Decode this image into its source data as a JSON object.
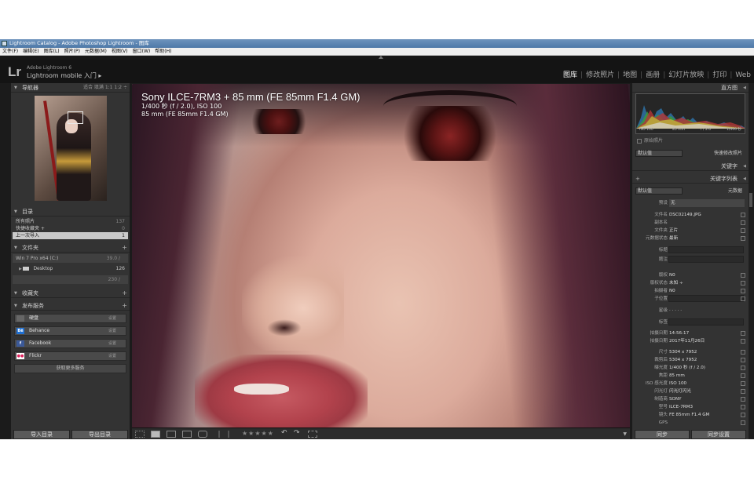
{
  "window": {
    "title": "Lightroom Catalog - Adobe Photoshop Lightroom - 图库"
  },
  "menu": [
    "文件(F)",
    "编辑(E)",
    "图库(L)",
    "照片(P)",
    "元数据(M)",
    "视图(V)",
    "窗口(W)",
    "帮助(H)"
  ],
  "identity": {
    "logo": "Lr",
    "line1": "Adobe Lightroom 6",
    "line2": "Lightroom mobile 入门 ▸"
  },
  "modules": [
    "图库",
    "修改照片",
    "地图",
    "画册",
    "幻灯片放映",
    "打印",
    "Web"
  ],
  "navigator": {
    "title": "导航器",
    "zoom": "适合   填满   1:1   1:2 ÷"
  },
  "catalog": {
    "title": "目录",
    "items": [
      {
        "label": "所有照片",
        "count": "137"
      },
      {
        "label": "快捷收藏夹 +",
        "count": "0"
      },
      {
        "label": "上一次导入",
        "count": "1"
      }
    ]
  },
  "folders": {
    "title": "文件夹",
    "volumes": [
      {
        "label": "Win 7 Pro x64 (C:)",
        "count": "39.0 / "
      },
      {
        "label": "",
        "count": "230 / "
      }
    ],
    "folder_items": [
      {
        "label": "Desktop",
        "count": "126"
      }
    ]
  },
  "collections": {
    "title": "收藏夹"
  },
  "publish": {
    "title": "发布服务",
    "services": [
      {
        "badge": "",
        "label": "硬盘",
        "set": "设置"
      },
      {
        "badge": "Bē",
        "label": "Behance",
        "set": "设置"
      },
      {
        "badge": "f",
        "label": "Facebook",
        "set": "设置"
      },
      {
        "badge": "●●",
        "label": "Flickr",
        "set": "设置"
      }
    ],
    "more": "获取更多服务"
  },
  "left_buttons": {
    "import": "导入目录",
    "export": "导出目录"
  },
  "overlay": {
    "line1": "Sony ILCE-7RM3 + 85 mm (FE 85mm F1.4 GM)",
    "line2": "1/400 秒 (f / 2.0), ISO 100",
    "line3": "85 mm (FE 85mm F1.4 GM)"
  },
  "toolbar": {
    "stars": "★★★★★"
  },
  "histogram": {
    "title": "直方图",
    "iso": "ISO 100",
    "focal": "85 mm",
    "aperture": "f / 2.0",
    "shutter": "1/400 秒",
    "original": "原始照片"
  },
  "quick_develop": {
    "preset": "默认值",
    "title": "快速修改照片"
  },
  "keywording": {
    "title": "关键字"
  },
  "keyword_list": {
    "title": "关键字列表"
  },
  "metadata": {
    "preset": "默认值",
    "title": "元数据",
    "preset_label": "预设",
    "preset_value": "无",
    "rows": [
      {
        "k": "文件名",
        "v": "DSC02149.JPG"
      },
      {
        "k": "副本名",
        "v": ""
      },
      {
        "k": "文件夹",
        "v": "正片"
      },
      {
        "k": "元数据状态",
        "v": "最新"
      },
      {
        "k": "标题",
        "v": ""
      },
      {
        "k": "题注",
        "v": ""
      },
      {
        "k": "版权",
        "v": "N0"
      },
      {
        "k": "版权状态",
        "v": "未知 ÷"
      },
      {
        "k": "拍摄者",
        "v": "N0"
      },
      {
        "k": "子位置",
        "v": ""
      },
      {
        "k": "星级",
        "v": "· · · · ·"
      },
      {
        "k": "标签",
        "v": ""
      },
      {
        "k": "拍摄日期",
        "v": "14:56:17"
      },
      {
        "k": "拍摄日期",
        "v": "2017年11月26日"
      },
      {
        "k": "尺寸",
        "v": "5304 x 7952"
      },
      {
        "k": "裁剪后",
        "v": "5304 x 7952"
      },
      {
        "k": "曝光度",
        "v": "1/400 秒 (f / 2.0)"
      },
      {
        "k": "焦距",
        "v": "85 mm"
      },
      {
        "k": "ISO 感光度",
        "v": "ISO 100"
      },
      {
        "k": "闪光灯",
        "v": "闪光灯闪光"
      },
      {
        "k": "制造商",
        "v": "SONY"
      },
      {
        "k": "型号",
        "v": "ILCE-7RM3"
      },
      {
        "k": "镜头",
        "v": "FE 85mm F1.4 GM"
      },
      {
        "k": "GPS",
        "v": ""
      }
    ]
  },
  "right_buttons": {
    "sync": "同步",
    "sync_settings": "同步设置"
  }
}
